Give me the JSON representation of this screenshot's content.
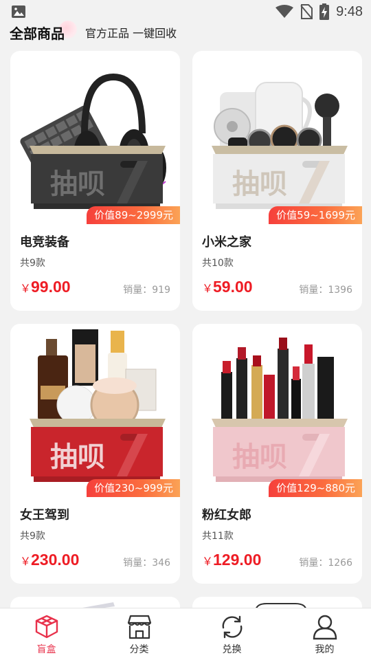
{
  "status_bar": {
    "time": "9:48"
  },
  "header": {
    "title": "全部商品",
    "tagline": "官方正品 一键回收"
  },
  "products": [
    {
      "name": "电竞装备",
      "count": "共9款",
      "currency": "￥",
      "price": "99.00",
      "sales": "销量：919",
      "price_range": "价值89~2999元",
      "box_color": "#3a3a3a",
      "box_label": "抽呗"
    },
    {
      "name": "小米之家",
      "count": "共10款",
      "currency": "￥",
      "price": "59.00",
      "sales": "销量：1396",
      "price_range": "价值59~1699元",
      "box_color": "#efefef",
      "box_label": "抽呗"
    },
    {
      "name": "女王驾到",
      "count": "共9款",
      "currency": "￥",
      "price": "230.00",
      "sales": "销量：346",
      "price_range": "价值230~999元",
      "box_color": "#c9252c",
      "box_label": "抽呗"
    },
    {
      "name": "粉红女郎",
      "count": "共11款",
      "currency": "￥",
      "price": "129.00",
      "sales": "销量：1266",
      "price_range": "价值129~880元",
      "box_color": "#f0c7cc",
      "box_label": "抽呗"
    }
  ],
  "tabs": [
    {
      "label": "盲盒",
      "icon": "blind-box-icon",
      "active": true
    },
    {
      "label": "分类",
      "icon": "store-icon",
      "active": false
    },
    {
      "label": "兑换",
      "icon": "exchange-icon",
      "active": false
    },
    {
      "label": "我的",
      "icon": "user-icon",
      "active": false
    }
  ],
  "colors": {
    "accent": "#e8314b",
    "price": "#ee1c24",
    "tag_start": "#f6403c",
    "tag_end": "#fba356"
  }
}
